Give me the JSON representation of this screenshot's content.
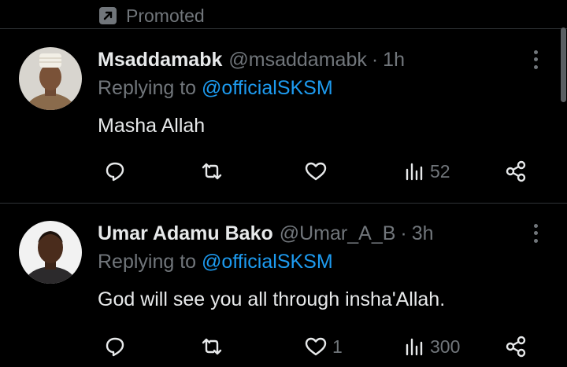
{
  "promoted": {
    "label": "Promoted"
  },
  "tweets": [
    {
      "name": "Msaddamabk",
      "handle": "@msaddamabk",
      "separator": "·",
      "time": "1h",
      "replying_prefix": "Replying to",
      "replying_to": "@officialSKSM",
      "text": "Masha Allah",
      "likes": "",
      "views": "52"
    },
    {
      "name": "Umar Adamu Bako",
      "handle": "@Umar_A_B",
      "separator": "·",
      "time": "3h",
      "replying_prefix": "Replying to",
      "replying_to": "@officialSKSM",
      "text": "God will see you all through insha'Allah.",
      "likes": "1",
      "views": "300"
    }
  ],
  "colors": {
    "background": "#000000",
    "text": "#e7e9ea",
    "muted": "#71767b",
    "link": "#1d9bf0"
  }
}
